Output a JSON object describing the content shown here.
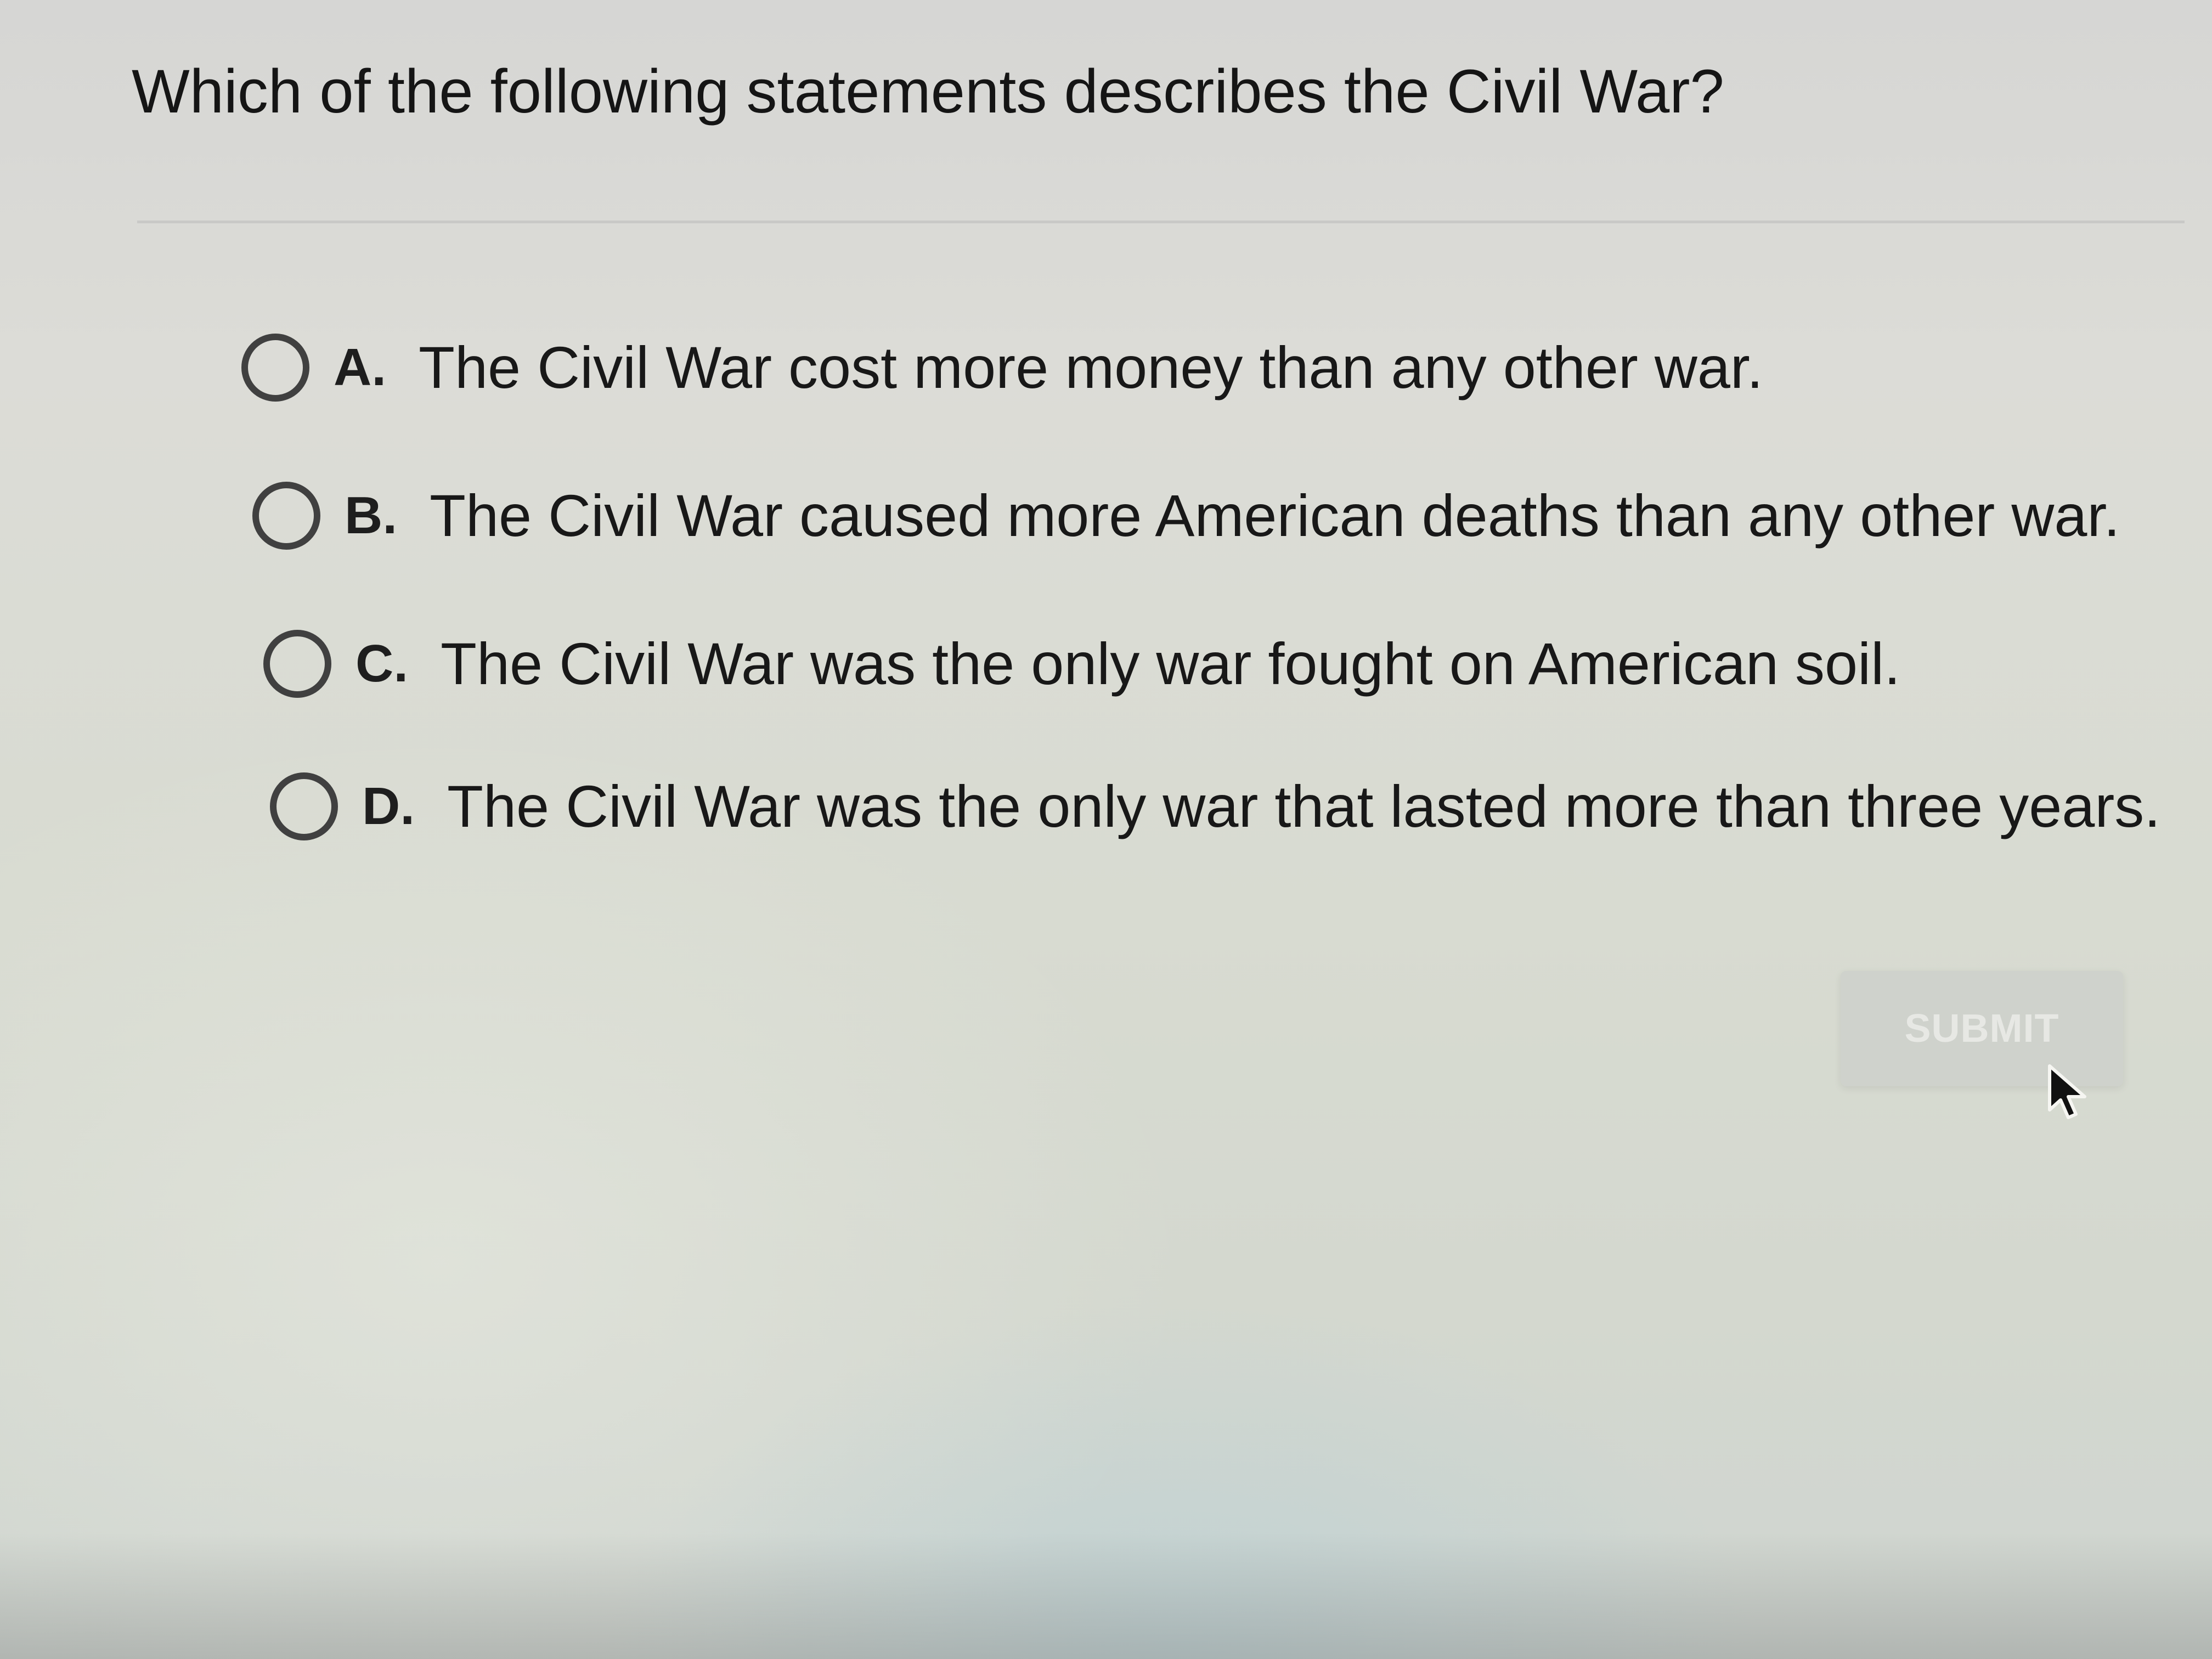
{
  "question": {
    "text": "Which of the following statements describes the Civil War?"
  },
  "options": [
    {
      "letter": "A.",
      "text": "The Civil War cost more money than any other war.",
      "selected": false
    },
    {
      "letter": "B.",
      "text": "The Civil War caused more American deaths than any other war.",
      "selected": false
    },
    {
      "letter": "C.",
      "text": "The Civil War was the only war fought on American soil.",
      "selected": false
    },
    {
      "letter": "D.",
      "text": "The Civil War was the only war that lasted more than three years.",
      "selected": false
    }
  ],
  "submit": {
    "label": "SUBMIT",
    "state": "disabled"
  },
  "colors": {
    "text": "#151515",
    "radio_border": "#404040",
    "submit_background": "#cfd2cc",
    "submit_text": "#e7e8e4"
  },
  "icons": {
    "radio": "radio-unchecked-icon",
    "cursor": "mouse-pointer-icon"
  }
}
